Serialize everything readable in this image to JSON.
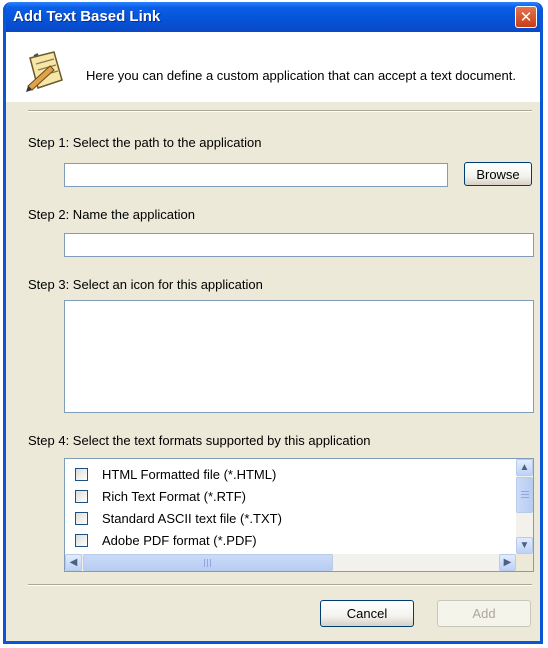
{
  "window": {
    "title": "Add Text Based Link",
    "close_icon": "close-icon"
  },
  "header": {
    "text": "Here you can define a custom application that can accept a text document.",
    "icon": "notepad-pencil-icon"
  },
  "step1": {
    "label": "Step 1: Select the path to the application",
    "value": "",
    "browse_label": "Browse"
  },
  "step2": {
    "label": "Step 2: Name the application",
    "value": ""
  },
  "step3": {
    "label": "Step 3: Select an icon for this application"
  },
  "step4": {
    "label": "Step 4: Select the text formats supported by this application",
    "formats": [
      "HTML Formatted file (*.HTML)",
      "Rich Text Format (*.RTF)",
      "Standard ASCII text file (*.TXT)",
      "Adobe PDF format (*.PDF)"
    ]
  },
  "buttons": {
    "cancel": "Cancel",
    "add": "Add"
  },
  "colors": {
    "title_bar": "#0553d7",
    "close_button": "#c73d17",
    "dialog_bg": "#ece9d8"
  }
}
